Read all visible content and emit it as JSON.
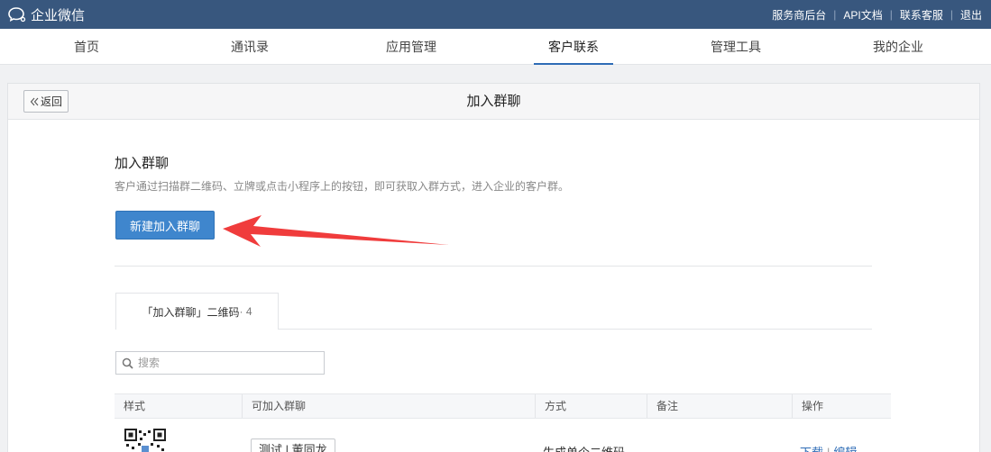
{
  "topbar": {
    "app_name": "企业微信",
    "links": [
      "服务商后台",
      "API文档",
      "联系客服",
      "退出"
    ]
  },
  "nav": {
    "items": [
      "首页",
      "通讯录",
      "应用管理",
      "客户联系",
      "管理工具",
      "我的企业"
    ],
    "active": "客户联系",
    "active_color": "#2e6cb6"
  },
  "panel": {
    "back_label": "返回",
    "title": "加入群聊"
  },
  "section": {
    "title": "加入群聊",
    "description": "客户通过扫描群二维码、立牌或点击小程序上的按钮，即可获取入群方式，进入企业的客户群。",
    "create_button": "新建加入群聊"
  },
  "tab": {
    "label": "「加入群聊」二维码",
    "count": " · 4"
  },
  "search": {
    "placeholder": "搜索",
    "value": ""
  },
  "table": {
    "columns": [
      "样式",
      "可加入群聊",
      "方式",
      "备注",
      "操作"
    ],
    "rows": [
      {
        "group": "测试 | 董同龙",
        "method": "生成单个二维码",
        "note": "",
        "actions": [
          "下载",
          "编辑"
        ]
      }
    ]
  },
  "colors": {
    "topbar": "#38577e",
    "primary": "#3f86cd",
    "link": "#2e6cb6",
    "annotation_arrow": "#f03c3c"
  }
}
